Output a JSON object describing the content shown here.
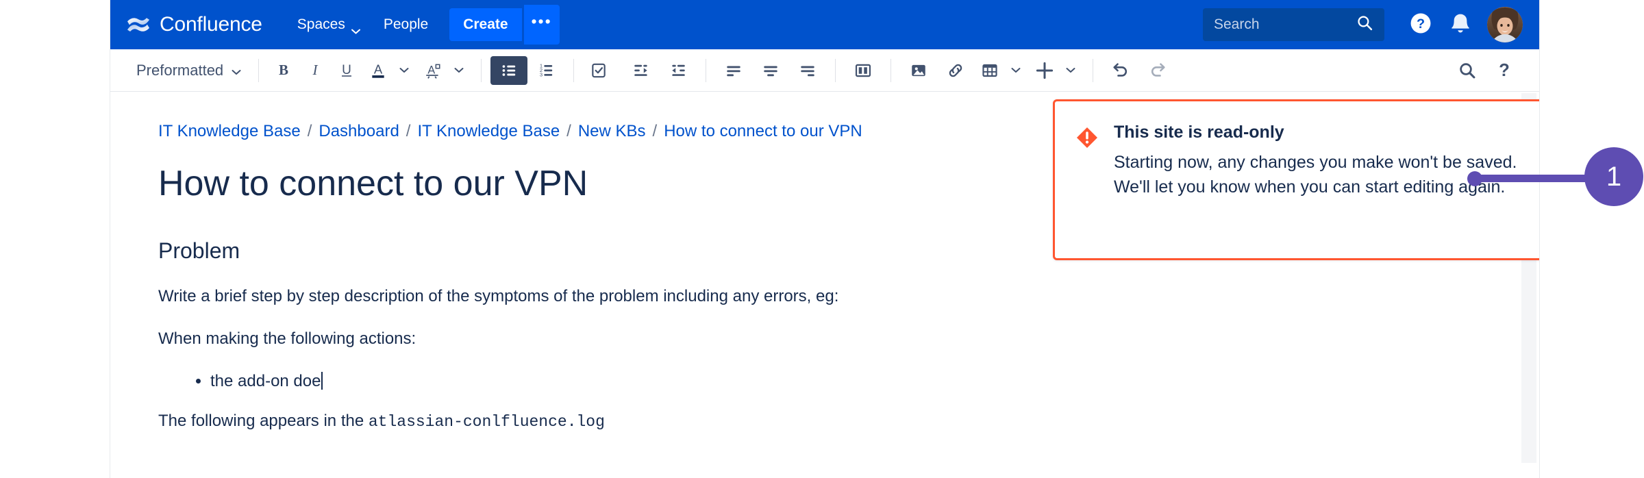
{
  "nav": {
    "brand": "Confluence",
    "brand_logo_icon": "confluence-logo-icon",
    "items": [
      {
        "label": "Spaces",
        "has_caret": true
      },
      {
        "label": "People",
        "has_caret": false
      }
    ],
    "create_label": "Create",
    "more_label": "•••",
    "search_placeholder": "Search",
    "search_icon": "search-icon",
    "help_icon": "help-circle-icon",
    "notifications_icon": "bell-icon",
    "avatar_icon": "user-avatar",
    "colors": {
      "nav_bg": "#0052CC",
      "create_bg": "#0065FF",
      "search_bg": "#03489F"
    }
  },
  "toolbar": {
    "style_label": "Preformatted",
    "buttons": [
      {
        "name": "bold",
        "label": "B"
      },
      {
        "name": "italic",
        "label": "I"
      },
      {
        "name": "underline",
        "label": "U"
      },
      {
        "name": "text-color",
        "label": "A"
      },
      {
        "name": "text-highlight",
        "label": "A"
      },
      {
        "name": "bullet-list",
        "label": "Bullet list",
        "active": true
      },
      {
        "name": "numbered-list",
        "label": "Numbered list"
      },
      {
        "name": "task-list",
        "label": "Task list"
      },
      {
        "name": "outdent",
        "label": "Outdent"
      },
      {
        "name": "indent",
        "label": "Indent"
      },
      {
        "name": "align-left",
        "label": "Align left"
      },
      {
        "name": "align-center",
        "label": "Align center"
      },
      {
        "name": "align-right",
        "label": "Align right"
      },
      {
        "name": "page-layout",
        "label": "Page layout"
      },
      {
        "name": "insert-image",
        "label": "Insert image"
      },
      {
        "name": "insert-link",
        "label": "Insert link"
      },
      {
        "name": "insert-table",
        "label": "Insert table"
      },
      {
        "name": "insert-more",
        "label": "Insert more"
      },
      {
        "name": "undo",
        "label": "Undo"
      },
      {
        "name": "redo",
        "label": "Redo"
      },
      {
        "name": "find-replace",
        "label": "Find and replace"
      },
      {
        "name": "help",
        "label": "?"
      }
    ],
    "find_label": "Find",
    "help_label": "?"
  },
  "breadcrumb": {
    "items": [
      "IT Knowledge Base",
      "Dashboard",
      "IT Knowledge Base",
      "New KBs",
      "How to connect to our VPN"
    ],
    "separator": "/"
  },
  "page": {
    "title": "How to connect to our VPN",
    "heading_problem": "Problem",
    "paragraph_1": "Write a brief step by step description of the symptoms of the problem including any errors, eg:",
    "paragraph_2": "When making the following actions:",
    "bullet_1": "the add-on doe",
    "paragraph_3_prefix": "The following appears in the ",
    "paragraph_3_code": "atlassian-conlfluence.log"
  },
  "flag": {
    "icon": "error-diamond-icon",
    "title": "This site is read-only",
    "description": "Starting now, any changes you make won't be saved. We'll let you know when you can start editing again.",
    "close_icon": "close-icon",
    "border_color": "#FF5630",
    "icon_color": "#FF5630"
  },
  "callout": {
    "number": "1",
    "color": "#5E4DB2"
  },
  "scrollbar": {
    "name": "content-vertical-scrollbar"
  }
}
